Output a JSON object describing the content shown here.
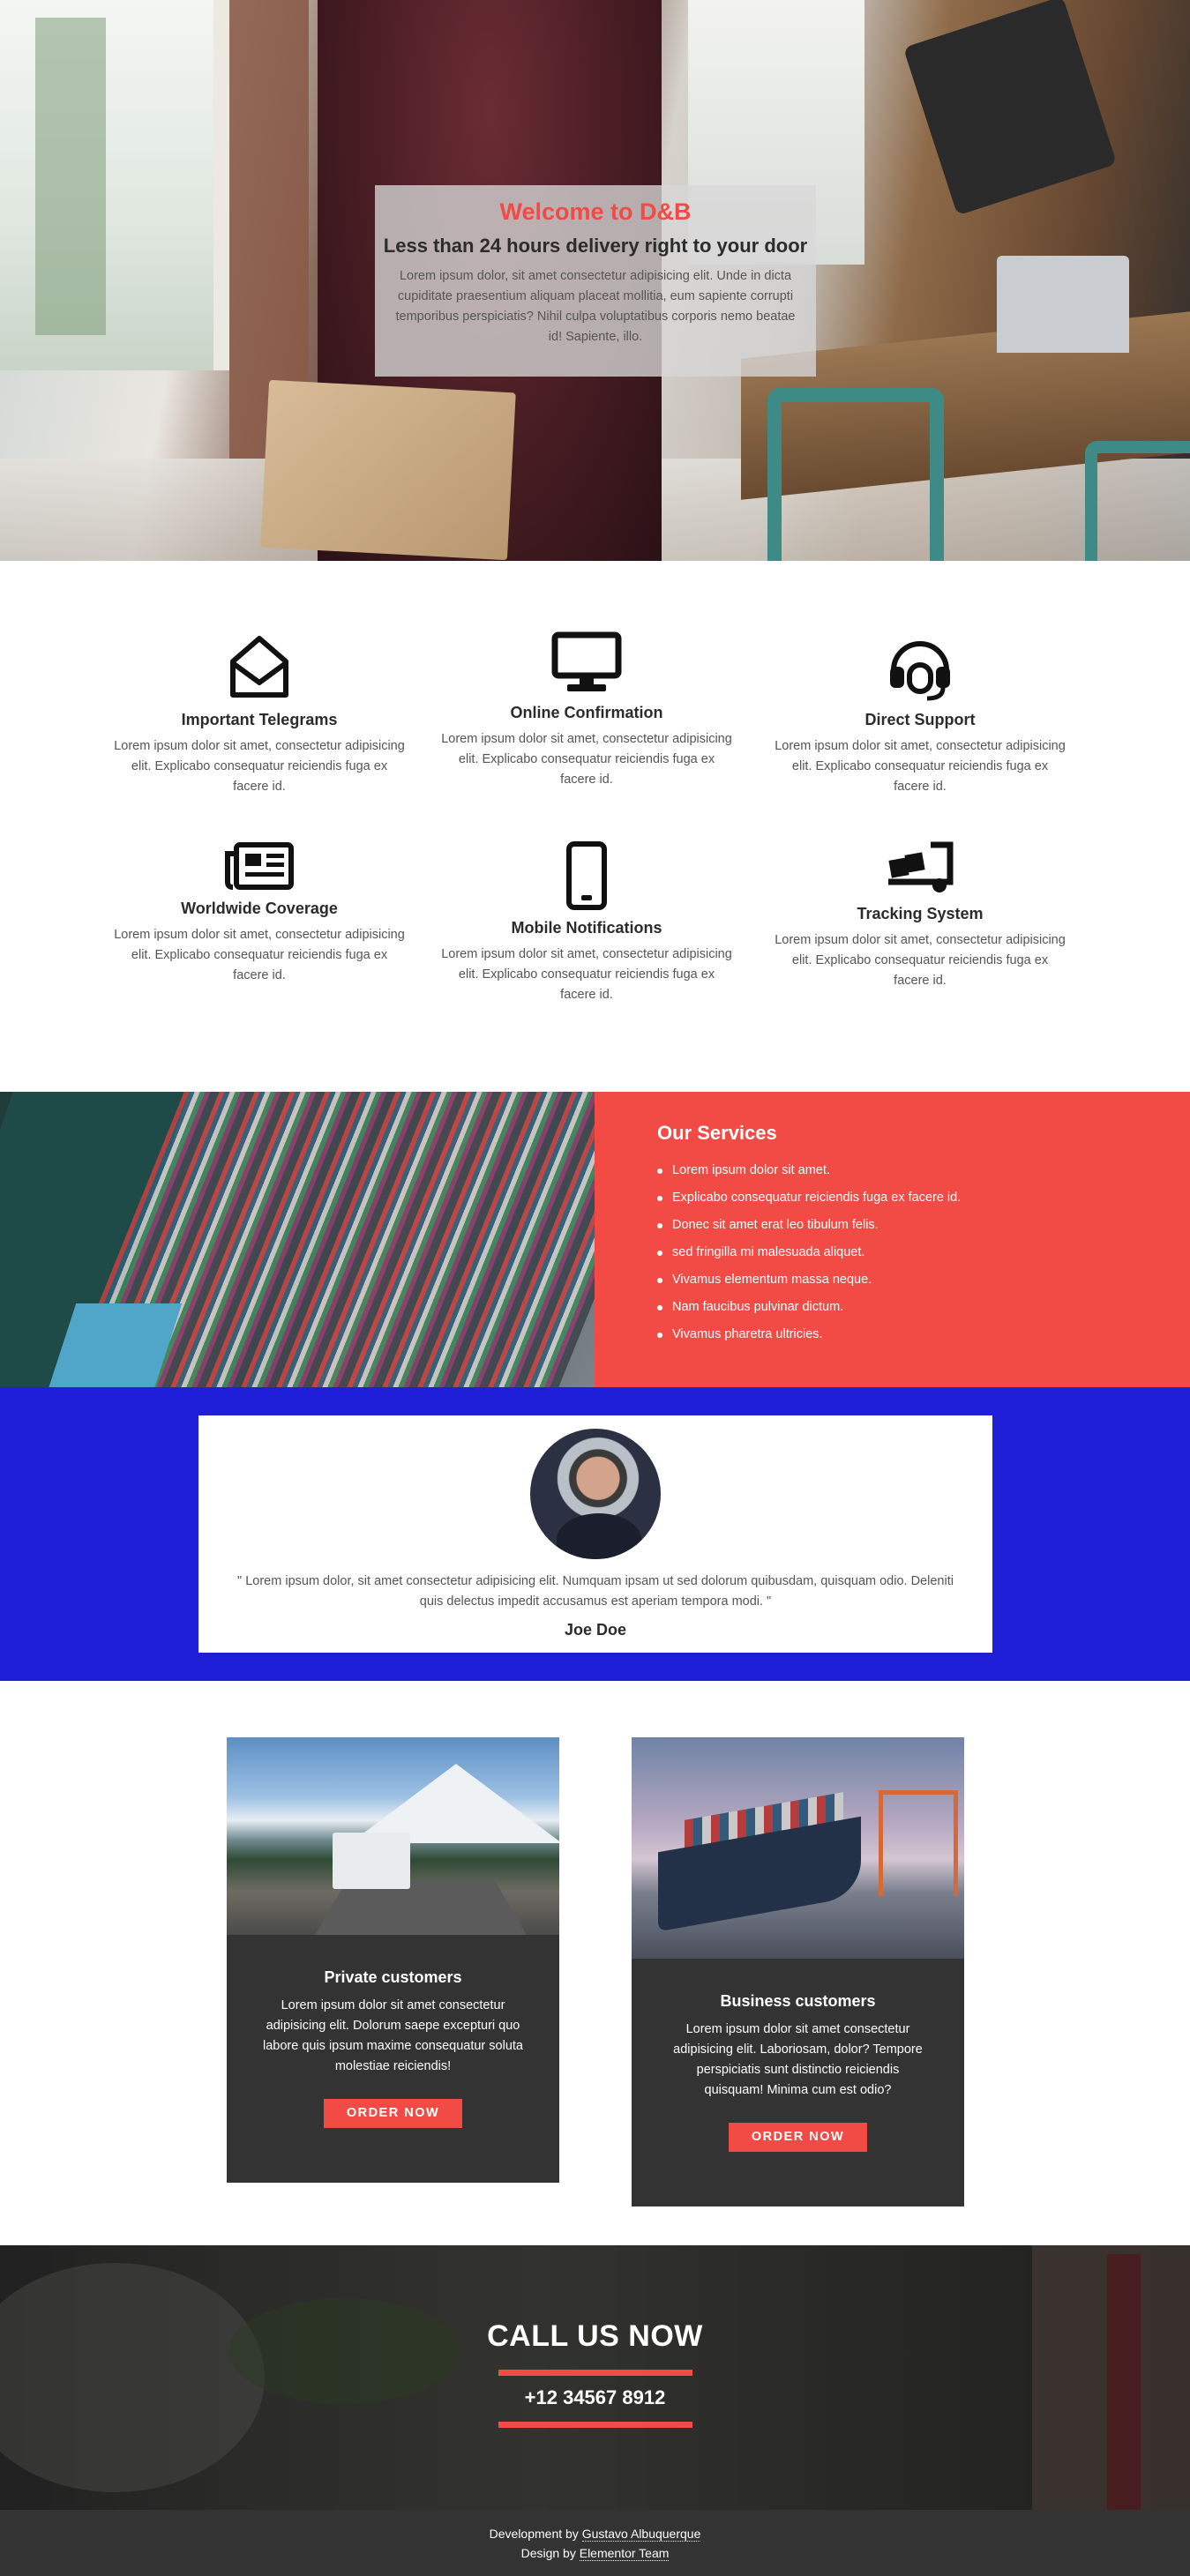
{
  "hero": {
    "title": "Welcome to D&B",
    "subtitle": "Less than 24 hours delivery right to your door",
    "text": "Lorem ipsum dolor, sit amet consectetur adipisicing elit. Unde in dicta cupiditate praesentium aliquam placeat mollitia, eum sapiente corrupti temporibus perspiciatis? Nihil culpa voluptatibus corporis nemo beatae id! Sapiente, illo."
  },
  "features": [
    {
      "icon": "envelope-open-icon",
      "title": "Important Telegrams",
      "text": "Lorem ipsum dolor sit amet, consectetur adipisicing elit. Explicabo consequatur reiciendis fuga ex facere id."
    },
    {
      "icon": "desktop-icon",
      "title": "Online Confirmation",
      "text": "Lorem ipsum dolor sit amet, consectetur adipisicing elit. Explicabo consequatur reiciendis fuga ex facere id."
    },
    {
      "icon": "headset-icon",
      "title": "Direct Support",
      "text": "Lorem ipsum dolor sit amet, consectetur adipisicing elit. Explicabo consequatur reiciendis fuga ex facere id."
    },
    {
      "icon": "newspaper-icon",
      "title": "Worldwide Coverage",
      "text": "Lorem ipsum dolor sit amet, consectetur adipisicing elit. Explicabo consequatur reiciendis fuga ex facere id."
    },
    {
      "icon": "mobile-phone-icon",
      "title": "Mobile Notifications",
      "text": "Lorem ipsum dolor sit amet, consectetur adipisicing elit. Explicabo consequatur reiciendis fuga ex facere id."
    },
    {
      "icon": "dolly-icon",
      "title": "Tracking System",
      "text": "Lorem ipsum dolor sit amet, consectetur adipisicing elit. Explicabo consequatur reiciendis fuga ex facere id."
    }
  ],
  "services": {
    "title": "Our Services",
    "items": [
      "Lorem ipsum dolor sit amet.",
      "Explicabo consequatur reiciendis fuga ex facere id.",
      "Donec sit amet erat leo tibulum felis.",
      "sed fringilla mi malesuada aliquet.",
      "Vivamus elementum massa neque.",
      "Nam faucibus pulvinar dictum.",
      "Vivamus pharetra ultricies."
    ]
  },
  "testimonial": {
    "quote": "\" Lorem ipsum dolor, sit amet consectetur adipisicing elit. Numquam ipsam ut sed dolorum quibusdam, quisquam odio. Deleniti quis delectus impedit accusamus est aperiam tempora modi. \"",
    "name": "Joe Doe"
  },
  "customers": [
    {
      "title": "Private customers",
      "text": "Lorem ipsum dolor sit amet consectetur adipisicing elit. Dolorum saepe excepturi quo labore quis ipsum maxime consequatur soluta molestiae reiciendis!",
      "button": "ORDER NOW"
    },
    {
      "title": "Business customers",
      "text": "Lorem ipsum dolor sit amet consectetur adipisicing elit. Laboriosam, dolor? Tempore perspiciatis sunt distinctio reiciendis quisquam! Minima cum est odio?",
      "button": "ORDER NOW"
    }
  ],
  "call": {
    "title": "CALL US NOW",
    "phone": "+12 34567 8912"
  },
  "footer": {
    "dev_prefix": "Development by",
    "dev_name": "Gustavo Albuquerque",
    "design_prefix": "Design by",
    "design_name": "Elementor Team"
  },
  "colors": {
    "accent": "#f24b45",
    "testimonial_bg": "#1f1ed8",
    "dark": "#333333"
  }
}
